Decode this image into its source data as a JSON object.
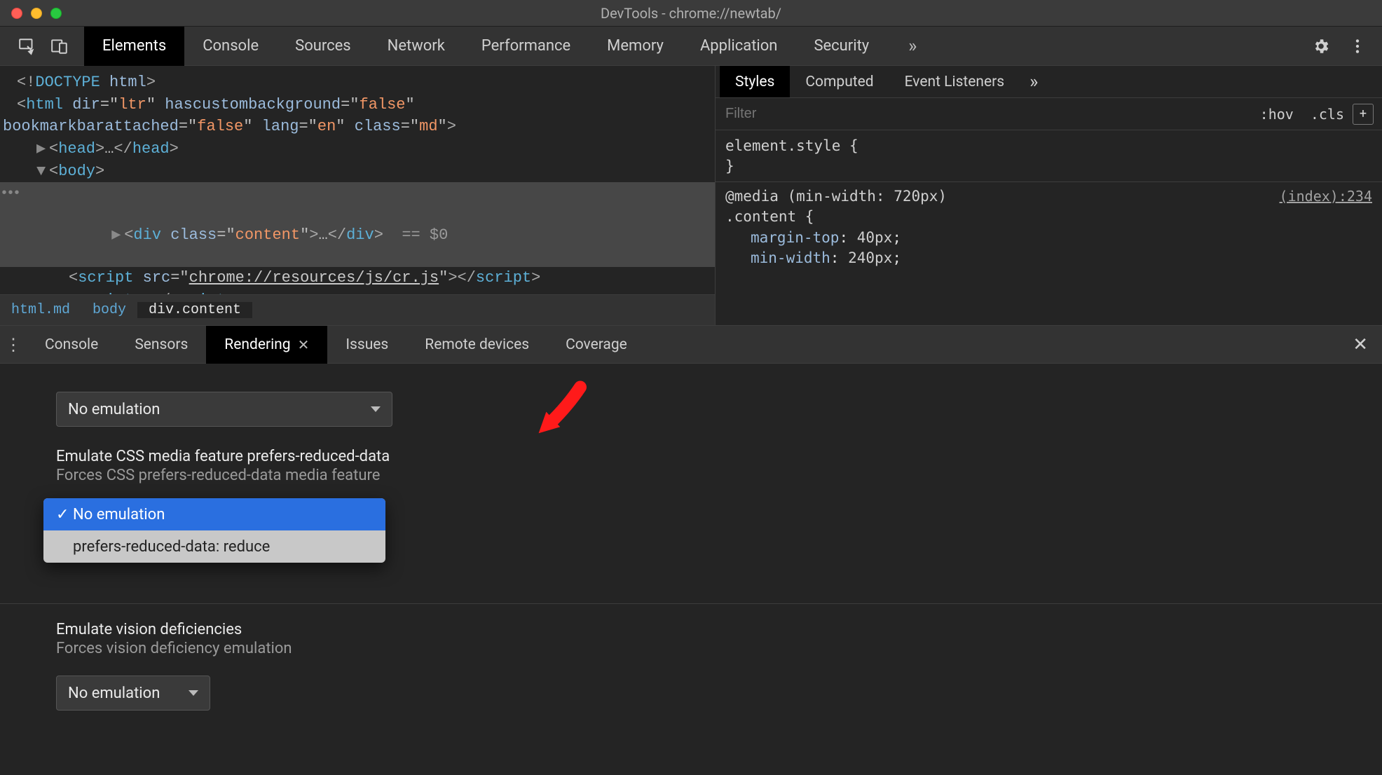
{
  "window": {
    "title": "DevTools - chrome://newtab/"
  },
  "toolbar": {
    "tabs": [
      "Elements",
      "Console",
      "Sources",
      "Network",
      "Performance",
      "Memory",
      "Application",
      "Security"
    ],
    "active_tab": "Elements"
  },
  "dom_source": {
    "doctype": "<!DOCTYPE html>",
    "html_open": {
      "dir": "ltr",
      "hascustombackground": "false",
      "bookmarkbarattached": "false",
      "lang": "en",
      "class": "md"
    },
    "head_collapsed": "<head>…</head>",
    "body_open": "<body>",
    "selected_div": {
      "tag": "div",
      "class": "content",
      "trailer": "== $0"
    },
    "script1_src": "chrome://resources/js/cr.js",
    "script2_collapsed": "<script>…</scr"
  },
  "breadcrumb": [
    "html.md",
    "body",
    "div.content"
  ],
  "styles": {
    "tabs": [
      "Styles",
      "Computed",
      "Event Listeners"
    ],
    "active_tab": "Styles",
    "filter_placeholder": "Filter",
    "hov_label": ":hov",
    "cls_label": ".cls",
    "element_style": "element.style {",
    "element_style_close": "}",
    "media_query": "@media (min-width: 720px)",
    "rule_selector": ".content {",
    "rule_link": "(index):234",
    "decls": [
      {
        "prop": "margin-top",
        "val": "40px"
      },
      {
        "prop": "min-width",
        "val": "240px"
      }
    ]
  },
  "drawer": {
    "tabs": [
      "Console",
      "Sensors",
      "Rendering",
      "Issues",
      "Remote devices",
      "Coverage"
    ],
    "active_tab": "Rendering",
    "section_upper_select": "No emulation",
    "prefers_reduced_data": {
      "title": "Emulate CSS media feature prefers-reduced-data",
      "subtitle": "Forces CSS prefers-reduced-data media feature",
      "options": [
        "No emulation",
        "prefers-reduced-data: reduce"
      ],
      "selected": "No emulation"
    },
    "vision": {
      "title": "Emulate vision deficiencies",
      "subtitle": "Forces vision deficiency emulation",
      "selected": "No emulation"
    }
  },
  "colors": {
    "annotation": "#ff1a1a"
  }
}
